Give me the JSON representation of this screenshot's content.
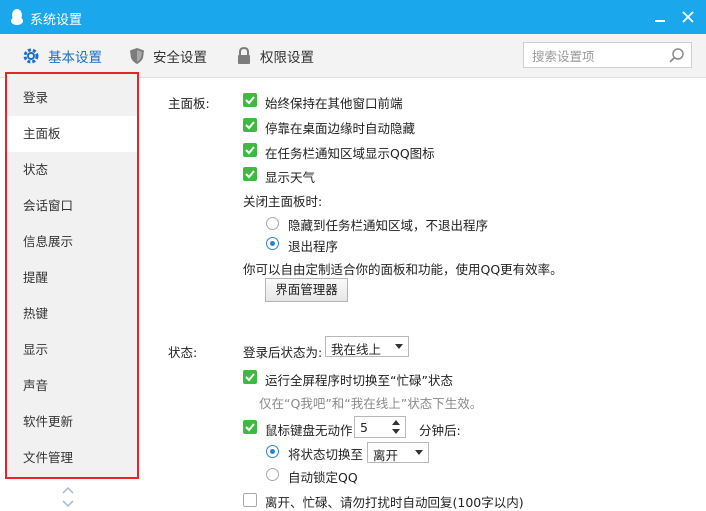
{
  "window": {
    "title": "系统设置"
  },
  "tabs": [
    {
      "label": "基本设置",
      "active": true,
      "icon": "gear-icon"
    },
    {
      "label": "安全设置",
      "active": false,
      "icon": "shield-icon"
    },
    {
      "label": "权限设置",
      "active": false,
      "icon": "lock-icon"
    }
  ],
  "search": {
    "placeholder": "搜索设置项"
  },
  "sidebar": {
    "items": [
      {
        "label": "登录"
      },
      {
        "label": "主面板",
        "selected": true
      },
      {
        "label": "状态"
      },
      {
        "label": "会话窗口"
      },
      {
        "label": "信息展示"
      },
      {
        "label": "提醒"
      },
      {
        "label": "热键"
      },
      {
        "label": "显示"
      },
      {
        "label": "声音"
      },
      {
        "label": "软件更新"
      },
      {
        "label": "文件管理"
      }
    ]
  },
  "panel": {
    "section_label": "主面板:",
    "options": [
      {
        "label": "始终保持在其他窗口前端",
        "checked": true
      },
      {
        "label": "停靠在桌面边缘时自动隐藏",
        "checked": true
      },
      {
        "label": "在任务栏通知区域显示QQ图标",
        "checked": true
      },
      {
        "label": "显示天气",
        "checked": true
      }
    ],
    "close_label": "关闭主面板时:",
    "close_options": [
      {
        "label": "隐藏到任务栏通知区域，不退出程序",
        "selected": false
      },
      {
        "label": "退出程序",
        "selected": true
      }
    ],
    "customize_text": "你可以自由定制适合你的面板和功能，使用QQ更有效率。",
    "manager_button": "界面管理器"
  },
  "status": {
    "section_label": "状态:",
    "after_login_label": "登录后状态为:",
    "after_login_value": "我在线上",
    "fullscreen_option": {
      "label": "运行全屏程序时切换至“忙碌”状态",
      "checked": true
    },
    "fullscreen_hint": "仅在“Q我吧”和“我在线上”状态下生效。",
    "idle_option": {
      "label": "鼠标键盘无动作",
      "checked": true
    },
    "idle_minutes": "5",
    "idle_suffix": "分钟后:",
    "switch_option": {
      "label": "将状态切换至",
      "selected": true
    },
    "switch_value": "离开",
    "lock_option": {
      "label": "自动锁定QQ",
      "selected": false
    },
    "auto_reply": {
      "label": "离开、忙碌、请勿打扰时自动回复(100字以内)",
      "checked": false
    }
  },
  "colors": {
    "titlebar": "#1aa7ec",
    "accent": "#1e6fc9",
    "checkbox_on": "#40b940",
    "highlight_border": "#e8232a"
  }
}
